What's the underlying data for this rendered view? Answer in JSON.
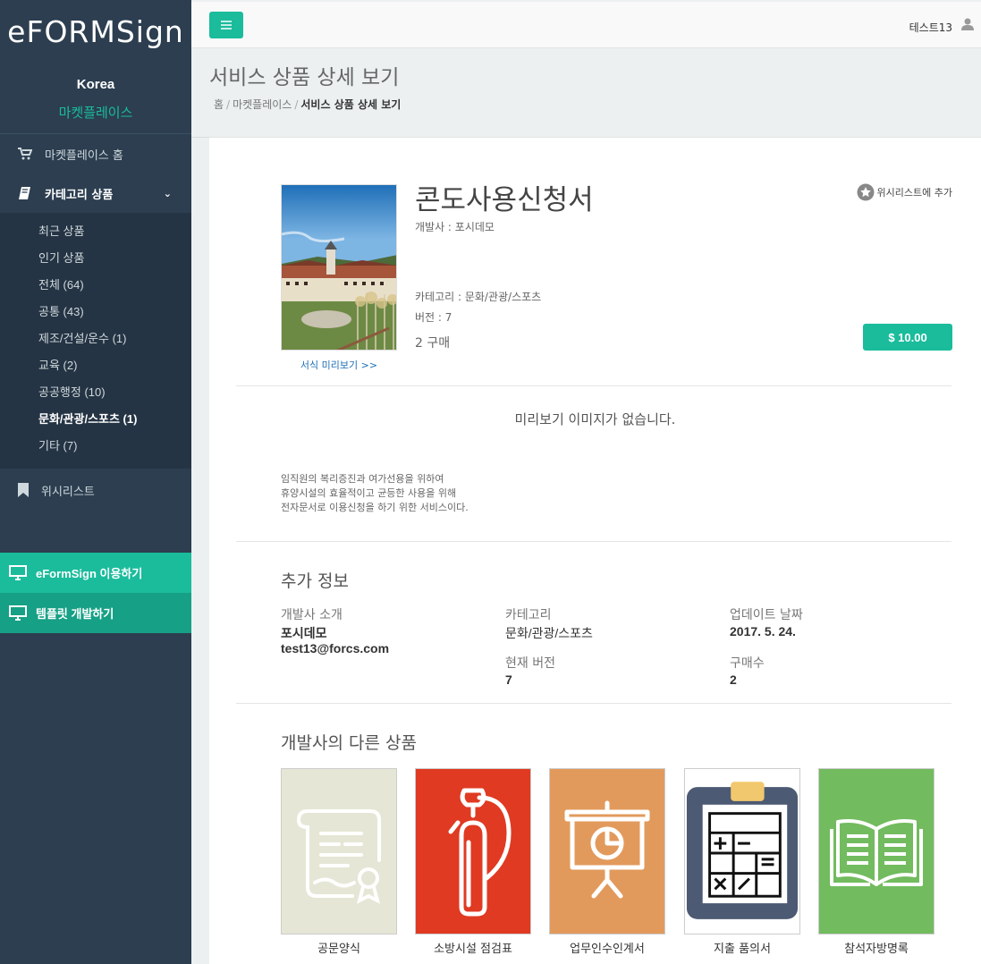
{
  "sidebar": {
    "logo": "eFORMSign",
    "country": "Korea",
    "market_link": "마켓플레이스",
    "home_label": "마켓플레이스 홈",
    "category_label": "카테고리 상품",
    "categories": [
      {
        "label": "최근 상품"
      },
      {
        "label": "인기 상품"
      },
      {
        "label": "전체 (64)"
      },
      {
        "label": "공통 (43)"
      },
      {
        "label": "제조/건설/운수 (1)"
      },
      {
        "label": "교육 (2)"
      },
      {
        "label": "공공행정 (10)"
      },
      {
        "label": "문화/관광/스포츠 (1)"
      },
      {
        "label": "기타 (7)"
      }
    ],
    "wishlist_label": "위시리스트",
    "use_button": "eFormSign 이용하기",
    "dev_button": "템플릿 개발하기",
    "colors": {
      "bg": "#2c3e50",
      "accent": "#1abc9c",
      "accent_dark": "#16a085"
    }
  },
  "topbar": {
    "user_name": "테스트13"
  },
  "header": {
    "title": "서비스 상품 상세 보기",
    "breadcrumb": [
      "홈",
      "마켓플레이스",
      "서비스 상품 상세 보기"
    ]
  },
  "product": {
    "title": "콘도사용신청서",
    "developer": "개발사 : 포시데모",
    "category": "카테고리 : 문화/관광/스포츠",
    "version": "버전 : 7",
    "purchases": "2 구매",
    "wishlist": "위시리스트에 추가",
    "price": "$ 10.00",
    "preview_link": "서식 미리보기 >>",
    "no_preview": "미리보기 이미지가 없습니다.",
    "description": [
      "임직원의 복리증진과 여가선용을 위하여",
      "휴양시설의 효율적이고 균등한 사용을 위해",
      "전자문서로 이용신청을 하기 위한 서비스이다."
    ]
  },
  "additional": {
    "title": "추가 정보",
    "developer_label": "개발사 소개",
    "developer_name": "포시데모",
    "developer_email": "test13@forcs.com",
    "category_label": "카테고리",
    "category_value": "문화/관광/스포츠",
    "updated_label": "업데이트 날짜",
    "updated_value": "2017. 5. 24.",
    "version_label": "현재 버전",
    "version_value": "7",
    "purchases_label": "구매수",
    "purchases_value": "2"
  },
  "other_products": {
    "title": "개발사의 다른 상품",
    "items": [
      {
        "name": "공문양식",
        "icon": "certificate-scroll-icon",
        "color": "#e6e6d6"
      },
      {
        "name": "소방시설 점검표",
        "icon": "fire-extinguisher-icon",
        "color": "#e03a22"
      },
      {
        "name": "업무인수인계서",
        "icon": "presentation-board-icon",
        "color": "#e29a5c"
      },
      {
        "name": "지출 품의서",
        "icon": "calculator-clipboard-icon",
        "color": "#ffffff"
      },
      {
        "name": "참석자방명록",
        "icon": "open-book-icon",
        "color": "#72bb5f"
      }
    ]
  }
}
